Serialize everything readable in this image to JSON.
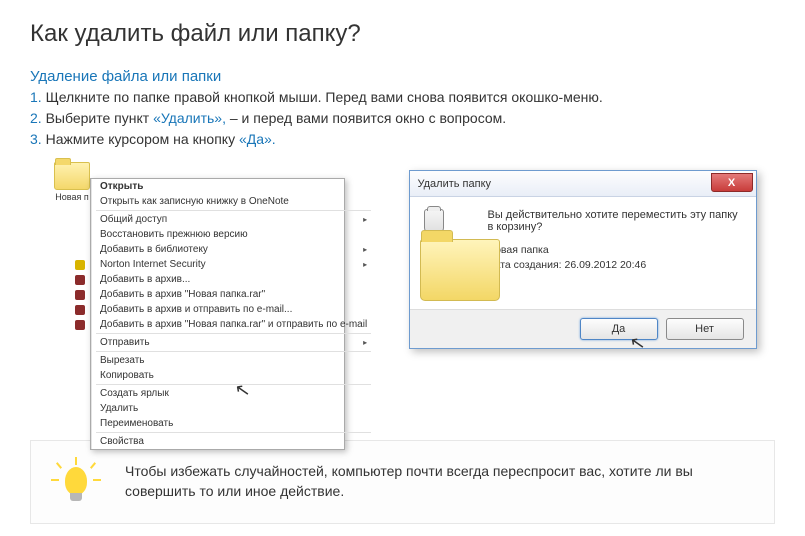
{
  "title": "Как удалить файл или папку?",
  "subtitle": "Удаление файла или папки",
  "steps": [
    {
      "num": "1.",
      "pre": " Щелкните по папке правой кнопкой мыши. Перед вами снова появится окошко-меню.",
      "q": "",
      "post": ""
    },
    {
      "num": "2.",
      "pre": " Выберите пункт ",
      "q": "«Удалить»,",
      "post": " – и перед вами появится окно с вопросом."
    },
    {
      "num": "3.",
      "pre": " Нажмите курсором на кнопку ",
      "q": "«Да».",
      "post": ""
    }
  ],
  "folder_label": "Новая п",
  "context_menu": {
    "open": "Открыть",
    "onenote": "Открыть как записную книжку в OneNote",
    "share": "Общий доступ",
    "restore": "Восстановить прежнюю версию",
    "library": "Добавить в библиотеку",
    "norton": "Norton Internet Security",
    "addarchive": "Добавить в архив...",
    "addrar": "Добавить в архив \"Новая папка.rar\"",
    "addemail": "Добавить в архив и отправить по e-mail...",
    "addraremail": "Добавить в архив \"Новая папка.rar\" и отправить по e-mail",
    "send": "Отправить",
    "cut": "Вырезать",
    "copy": "Копировать",
    "shortcut": "Создать ярлык",
    "delete": "Удалить",
    "rename": "Переименовать",
    "props": "Свойства"
  },
  "dialog": {
    "title": "Удалить папку",
    "question": "Вы действительно хотите переместить эту папку в корзину?",
    "name": "Новая папка",
    "date": "Дата создания: 26.09.2012 20:46",
    "yes": "Да",
    "no": "Нет"
  },
  "tip": "Чтобы избежать случайностей, компьютер почти всегда переспросит вас, хотите ли вы совершить то или иное действие."
}
